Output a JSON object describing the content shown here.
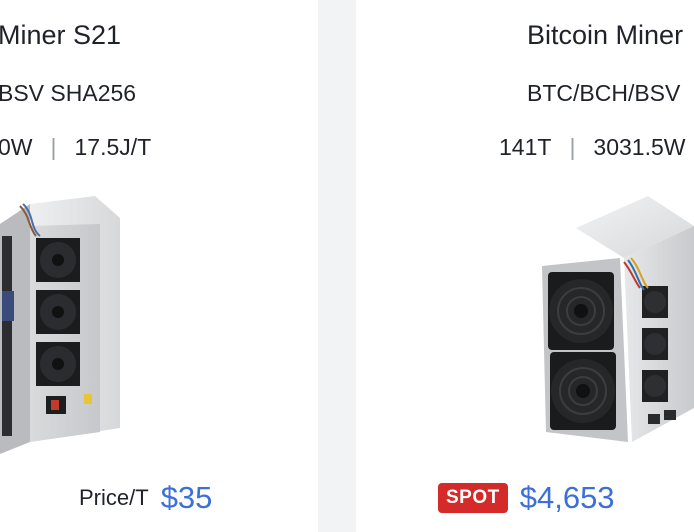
{
  "cards": [
    {
      "title": "Miner S21",
      "algorithm": "BSV SHA256",
      "power": "0W",
      "efficiency": "17.5J/T",
      "price_label": "Price/T",
      "price": "$35",
      "image": "miner-unit"
    },
    {
      "title": "Bitcoin Miner",
      "algorithm": "BTC/BCH/BSV",
      "hashrate": "141T",
      "power": "3031.5W",
      "badge": "SPOT",
      "price": "$4,653",
      "image": "miner-unit"
    }
  ],
  "separator": "|",
  "colors": {
    "price": "#3d6fd8",
    "badge": "#d42a2a",
    "text": "#1f2329",
    "page_bg": "#f3f4f6"
  }
}
